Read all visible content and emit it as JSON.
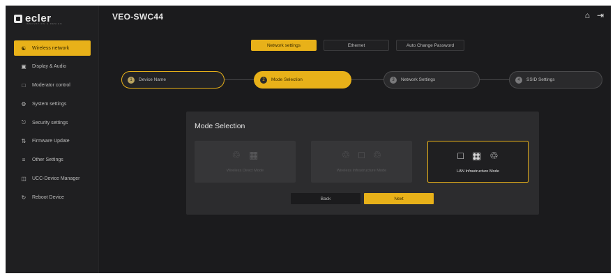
{
  "brand": {
    "logo_text": "ecler",
    "logo_subtext": "INNOVATION & DESIGN"
  },
  "header": {
    "device_name": "VEO-SWC44",
    "home_icon": "home-icon",
    "logout_icon": "logout-icon"
  },
  "sidebar": {
    "items": [
      {
        "label": "Wireless network",
        "icon": "network-icon",
        "active": true
      },
      {
        "label": "Display & Audio",
        "icon": "display-icon",
        "active": false
      },
      {
        "label": "Moderator control",
        "icon": "moderator-icon",
        "active": false
      },
      {
        "label": "System settings",
        "icon": "gear-icon",
        "active": false
      },
      {
        "label": "Security settings",
        "icon": "lock-icon",
        "active": false
      },
      {
        "label": "Firmware Update",
        "icon": "firmware-icon",
        "active": false
      },
      {
        "label": "Other Settings",
        "icon": "sliders-icon",
        "active": false
      },
      {
        "label": "UCC-Device Manager",
        "icon": "device-manager-icon",
        "active": false
      },
      {
        "label": "Reboot Device",
        "icon": "reboot-icon",
        "active": false
      }
    ]
  },
  "tabs": [
    {
      "label": "Network settings",
      "active": true
    },
    {
      "label": "Ethernet",
      "active": false
    },
    {
      "label": "Auto Change Password",
      "active": false
    }
  ],
  "stepper": {
    "steps": [
      {
        "number": "1",
        "label": "Device Name",
        "state": "done"
      },
      {
        "number": "2",
        "label": "Mode Selection",
        "state": "current"
      },
      {
        "number": "3",
        "label": "Network Settings",
        "state": "pending"
      },
      {
        "number": "4",
        "label": "SSID Settings",
        "state": "pending"
      }
    ]
  },
  "mode_panel": {
    "title": "Mode Selection",
    "cards": [
      {
        "label": "Wireless Direct Mode",
        "icons": [
          "antenna-icon",
          "cast-icon"
        ],
        "selected": false
      },
      {
        "label": "Wireless Infrastructure Mode",
        "icons": [
          "antenna-icon",
          "monitor-icon",
          "antenna-icon"
        ],
        "selected": false
      },
      {
        "label": "LAN Infrastructure Mode",
        "icons": [
          "monitor-icon",
          "cast-icon",
          "antenna-icon"
        ],
        "selected": true
      }
    ],
    "back_label": "Back",
    "next_label": "Next"
  },
  "colors": {
    "accent": "#e8b119",
    "background": "#1b1b1d",
    "panel": "#2c2c2e"
  }
}
